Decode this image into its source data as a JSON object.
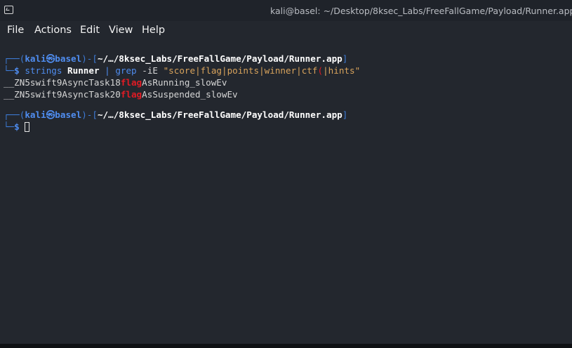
{
  "window": {
    "title": "kali@basel: ~/Desktop/8ksec_Labs/FreeFallGame/Payload/Runner.app",
    "icon": "terminal-icon"
  },
  "menu": [
    "File",
    "Actions",
    "Edit",
    "View",
    "Help"
  ],
  "prompt1": {
    "top_left": "┌──(",
    "user": "kali",
    "at": "㉿",
    "host": "basel",
    "sep": ")-[",
    "path": "~/…/8ksec_Labs/FreeFallGame/Payload/Runner.app",
    "close": "]",
    "bottom_left": "└─",
    "dollar": "$",
    "cmd1": "strings",
    "arg1": "Runner",
    "pipe": "|",
    "cmd2": "grep",
    "flag": "-iE",
    "pattern_a": "\"score|flag|points|winner|ctf",
    "pattern_mid": "(",
    "pattern_b": "|hints\""
  },
  "output": [
    {
      "pre": "__ZN5swift9AsyncTask18",
      "match": "flag",
      "post": "AsRunning_slowEv"
    },
    {
      "pre": "__ZN5swift9AsyncTask20",
      "match": "flag",
      "post": "AsSuspended_slowEv"
    }
  ],
  "prompt2": {
    "top_left": "┌──(",
    "user": "kali",
    "at": "㉿",
    "host": "basel",
    "sep": ")-[",
    "path": "~/…/8ksec_Labs/FreeFallGame/Payload/Runner.app",
    "close": "]",
    "bottom_left": "└─",
    "dollar": "$"
  },
  "colors": {
    "background": "#23272e",
    "prompt_blue": "#4f8df0",
    "match_red": "#e01b24",
    "string_orange": "#d8a35c"
  }
}
